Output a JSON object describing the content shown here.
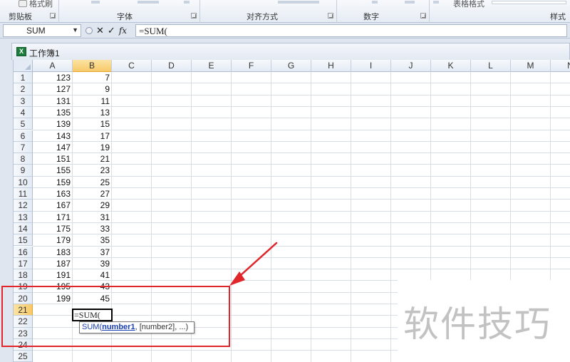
{
  "ribbon": {
    "format_painter_label": "格式刷",
    "table_format_label": "表格格式",
    "groups": [
      {
        "label": "剪贴板"
      },
      {
        "label": "字体"
      },
      {
        "label": "对齐方式"
      },
      {
        "label": "数字"
      },
      {
        "label": "样式"
      }
    ]
  },
  "formula_bar": {
    "name_box": "SUM",
    "cancel_symbol": "✕",
    "enter_symbol": "✓",
    "fx_label": "fx",
    "formula": "=SUM("
  },
  "workbook": {
    "title": "工作簿1",
    "icon_label": "X"
  },
  "sheet": {
    "columns": [
      "A",
      "B",
      "C",
      "D",
      "E",
      "F",
      "G",
      "H",
      "I",
      "J",
      "K",
      "L",
      "M",
      "N"
    ],
    "active_column": "B",
    "active_row": 21,
    "rows": [
      {
        "row": "1",
        "a": "123",
        "b": "7"
      },
      {
        "row": "2",
        "a": "127",
        "b": "9"
      },
      {
        "row": "3",
        "a": "131",
        "b": "11"
      },
      {
        "row": "4",
        "a": "135",
        "b": "13"
      },
      {
        "row": "5",
        "a": "139",
        "b": "15"
      },
      {
        "row": "6",
        "a": "143",
        "b": "17"
      },
      {
        "row": "7",
        "a": "147",
        "b": "19"
      },
      {
        "row": "8",
        "a": "151",
        "b": "21"
      },
      {
        "row": "9",
        "a": "155",
        "b": "23"
      },
      {
        "row": "10",
        "a": "159",
        "b": "25"
      },
      {
        "row": "11",
        "a": "163",
        "b": "27"
      },
      {
        "row": "12",
        "a": "167",
        "b": "29"
      },
      {
        "row": "13",
        "a": "171",
        "b": "31"
      },
      {
        "row": "14",
        "a": "175",
        "b": "33"
      },
      {
        "row": "15",
        "a": "179",
        "b": "35"
      },
      {
        "row": "16",
        "a": "183",
        "b": "37"
      },
      {
        "row": "17",
        "a": "187",
        "b": "39"
      },
      {
        "row": "18",
        "a": "191",
        "b": "41"
      },
      {
        "row": "19",
        "a": "195",
        "b": "43"
      },
      {
        "row": "20",
        "a": "199",
        "b": "45"
      },
      {
        "row": "21",
        "a": "",
        "b": ""
      },
      {
        "row": "22",
        "a": "",
        "b": ""
      },
      {
        "row": "23",
        "a": "",
        "b": ""
      },
      {
        "row": "24",
        "a": "",
        "b": ""
      },
      {
        "row": "25",
        "a": "",
        "b": ""
      }
    ],
    "active_cell_text": "=SUM(",
    "tooltip": {
      "fn": "SUM(",
      "arg1": "number1",
      "rest": ", [number2], ...)"
    }
  },
  "annotation": {
    "color": "#e0262a",
    "watermark": "软件技巧"
  }
}
